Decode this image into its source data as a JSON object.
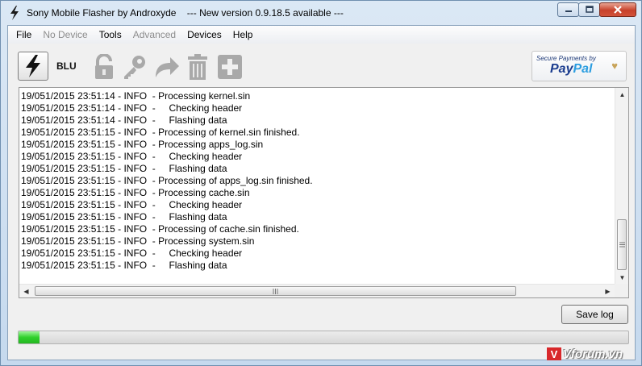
{
  "window": {
    "title": "Sony Mobile Flasher by Androxyde    --- New version 0.9.18.5 available ---"
  },
  "menu": [
    {
      "label": "File",
      "enabled": true
    },
    {
      "label": "No Device",
      "enabled": false
    },
    {
      "label": "Tools",
      "enabled": true
    },
    {
      "label": "Advanced",
      "enabled": false
    },
    {
      "label": "Devices",
      "enabled": true
    },
    {
      "label": "Help",
      "enabled": true
    }
  ],
  "toolbar": {
    "flash_icon": "lightning-bolt-icon",
    "device_label": "BLU",
    "icons": [
      "unlock-icon",
      "key-icon",
      "redo-arrow-icon",
      "trash-icon",
      "plus-icon"
    ],
    "paypal": {
      "tagline": "Secure Payments by",
      "brand_pay": "Pay",
      "brand_pal": "Pal"
    }
  },
  "log": [
    "19/051/2015 23:51:14 - INFO  - Processing kernel.sin",
    "19/051/2015 23:51:14 - INFO  -     Checking header",
    "19/051/2015 23:51:14 - INFO  -     Flashing data",
    "19/051/2015 23:51:15 - INFO  - Processing of kernel.sin finished.",
    "19/051/2015 23:51:15 - INFO  - Processing apps_log.sin",
    "19/051/2015 23:51:15 - INFO  -     Checking header",
    "19/051/2015 23:51:15 - INFO  -     Flashing data",
    "19/051/2015 23:51:15 - INFO  - Processing of apps_log.sin finished.",
    "19/051/2015 23:51:15 - INFO  - Processing cache.sin",
    "19/051/2015 23:51:15 - INFO  -     Checking header",
    "19/051/2015 23:51:15 - INFO  -     Flashing data",
    "19/051/2015 23:51:15 - INFO  - Processing of cache.sin finished.",
    "19/051/2015 23:51:15 - INFO  - Processing system.sin",
    "19/051/2015 23:51:15 - INFO  -     Checking header",
    "19/051/2015 23:51:15 - INFO  -     Flashing data"
  ],
  "buttons": {
    "save_log": "Save log"
  },
  "progress": {
    "fraction": 0.035
  },
  "watermark": {
    "logo_letter": "V",
    "text": "Vforum.vn"
  }
}
